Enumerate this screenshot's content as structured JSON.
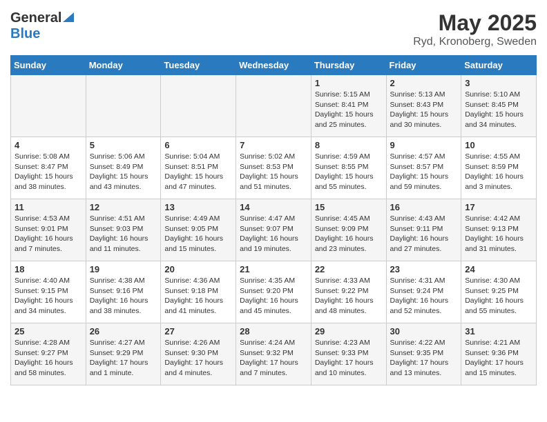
{
  "header": {
    "logo_general": "General",
    "logo_blue": "Blue",
    "title": "May 2025",
    "subtitle": "Ryd, Kronoberg, Sweden"
  },
  "weekdays": [
    "Sunday",
    "Monday",
    "Tuesday",
    "Wednesday",
    "Thursday",
    "Friday",
    "Saturday"
  ],
  "weeks": [
    [
      {
        "day": "",
        "sunrise": "",
        "sunset": "",
        "daylight": ""
      },
      {
        "day": "",
        "sunrise": "",
        "sunset": "",
        "daylight": ""
      },
      {
        "day": "",
        "sunrise": "",
        "sunset": "",
        "daylight": ""
      },
      {
        "day": "",
        "sunrise": "",
        "sunset": "",
        "daylight": ""
      },
      {
        "day": "1",
        "sunrise": "Sunrise: 5:15 AM",
        "sunset": "Sunset: 8:41 PM",
        "daylight": "Daylight: 15 hours and 25 minutes."
      },
      {
        "day": "2",
        "sunrise": "Sunrise: 5:13 AM",
        "sunset": "Sunset: 8:43 PM",
        "daylight": "Daylight: 15 hours and 30 minutes."
      },
      {
        "day": "3",
        "sunrise": "Sunrise: 5:10 AM",
        "sunset": "Sunset: 8:45 PM",
        "daylight": "Daylight: 15 hours and 34 minutes."
      }
    ],
    [
      {
        "day": "4",
        "sunrise": "Sunrise: 5:08 AM",
        "sunset": "Sunset: 8:47 PM",
        "daylight": "Daylight: 15 hours and 38 minutes."
      },
      {
        "day": "5",
        "sunrise": "Sunrise: 5:06 AM",
        "sunset": "Sunset: 8:49 PM",
        "daylight": "Daylight: 15 hours and 43 minutes."
      },
      {
        "day": "6",
        "sunrise": "Sunrise: 5:04 AM",
        "sunset": "Sunset: 8:51 PM",
        "daylight": "Daylight: 15 hours and 47 minutes."
      },
      {
        "day": "7",
        "sunrise": "Sunrise: 5:02 AM",
        "sunset": "Sunset: 8:53 PM",
        "daylight": "Daylight: 15 hours and 51 minutes."
      },
      {
        "day": "8",
        "sunrise": "Sunrise: 4:59 AM",
        "sunset": "Sunset: 8:55 PM",
        "daylight": "Daylight: 15 hours and 55 minutes."
      },
      {
        "day": "9",
        "sunrise": "Sunrise: 4:57 AM",
        "sunset": "Sunset: 8:57 PM",
        "daylight": "Daylight: 15 hours and 59 minutes."
      },
      {
        "day": "10",
        "sunrise": "Sunrise: 4:55 AM",
        "sunset": "Sunset: 8:59 PM",
        "daylight": "Daylight: 16 hours and 3 minutes."
      }
    ],
    [
      {
        "day": "11",
        "sunrise": "Sunrise: 4:53 AM",
        "sunset": "Sunset: 9:01 PM",
        "daylight": "Daylight: 16 hours and 7 minutes."
      },
      {
        "day": "12",
        "sunrise": "Sunrise: 4:51 AM",
        "sunset": "Sunset: 9:03 PM",
        "daylight": "Daylight: 16 hours and 11 minutes."
      },
      {
        "day": "13",
        "sunrise": "Sunrise: 4:49 AM",
        "sunset": "Sunset: 9:05 PM",
        "daylight": "Daylight: 16 hours and 15 minutes."
      },
      {
        "day": "14",
        "sunrise": "Sunrise: 4:47 AM",
        "sunset": "Sunset: 9:07 PM",
        "daylight": "Daylight: 16 hours and 19 minutes."
      },
      {
        "day": "15",
        "sunrise": "Sunrise: 4:45 AM",
        "sunset": "Sunset: 9:09 PM",
        "daylight": "Daylight: 16 hours and 23 minutes."
      },
      {
        "day": "16",
        "sunrise": "Sunrise: 4:43 AM",
        "sunset": "Sunset: 9:11 PM",
        "daylight": "Daylight: 16 hours and 27 minutes."
      },
      {
        "day": "17",
        "sunrise": "Sunrise: 4:42 AM",
        "sunset": "Sunset: 9:13 PM",
        "daylight": "Daylight: 16 hours and 31 minutes."
      }
    ],
    [
      {
        "day": "18",
        "sunrise": "Sunrise: 4:40 AM",
        "sunset": "Sunset: 9:15 PM",
        "daylight": "Daylight: 16 hours and 34 minutes."
      },
      {
        "day": "19",
        "sunrise": "Sunrise: 4:38 AM",
        "sunset": "Sunset: 9:16 PM",
        "daylight": "Daylight: 16 hours and 38 minutes."
      },
      {
        "day": "20",
        "sunrise": "Sunrise: 4:36 AM",
        "sunset": "Sunset: 9:18 PM",
        "daylight": "Daylight: 16 hours and 41 minutes."
      },
      {
        "day": "21",
        "sunrise": "Sunrise: 4:35 AM",
        "sunset": "Sunset: 9:20 PM",
        "daylight": "Daylight: 16 hours and 45 minutes."
      },
      {
        "day": "22",
        "sunrise": "Sunrise: 4:33 AM",
        "sunset": "Sunset: 9:22 PM",
        "daylight": "Daylight: 16 hours and 48 minutes."
      },
      {
        "day": "23",
        "sunrise": "Sunrise: 4:31 AM",
        "sunset": "Sunset: 9:24 PM",
        "daylight": "Daylight: 16 hours and 52 minutes."
      },
      {
        "day": "24",
        "sunrise": "Sunrise: 4:30 AM",
        "sunset": "Sunset: 9:25 PM",
        "daylight": "Daylight: 16 hours and 55 minutes."
      }
    ],
    [
      {
        "day": "25",
        "sunrise": "Sunrise: 4:28 AM",
        "sunset": "Sunset: 9:27 PM",
        "daylight": "Daylight: 16 hours and 58 minutes."
      },
      {
        "day": "26",
        "sunrise": "Sunrise: 4:27 AM",
        "sunset": "Sunset: 9:29 PM",
        "daylight": "Daylight: 17 hours and 1 minute."
      },
      {
        "day": "27",
        "sunrise": "Sunrise: 4:26 AM",
        "sunset": "Sunset: 9:30 PM",
        "daylight": "Daylight: 17 hours and 4 minutes."
      },
      {
        "day": "28",
        "sunrise": "Sunrise: 4:24 AM",
        "sunset": "Sunset: 9:32 PM",
        "daylight": "Daylight: 17 hours and 7 minutes."
      },
      {
        "day": "29",
        "sunrise": "Sunrise: 4:23 AM",
        "sunset": "Sunset: 9:33 PM",
        "daylight": "Daylight: 17 hours and 10 minutes."
      },
      {
        "day": "30",
        "sunrise": "Sunrise: 4:22 AM",
        "sunset": "Sunset: 9:35 PM",
        "daylight": "Daylight: 17 hours and 13 minutes."
      },
      {
        "day": "31",
        "sunrise": "Sunrise: 4:21 AM",
        "sunset": "Sunset: 9:36 PM",
        "daylight": "Daylight: 17 hours and 15 minutes."
      }
    ]
  ]
}
